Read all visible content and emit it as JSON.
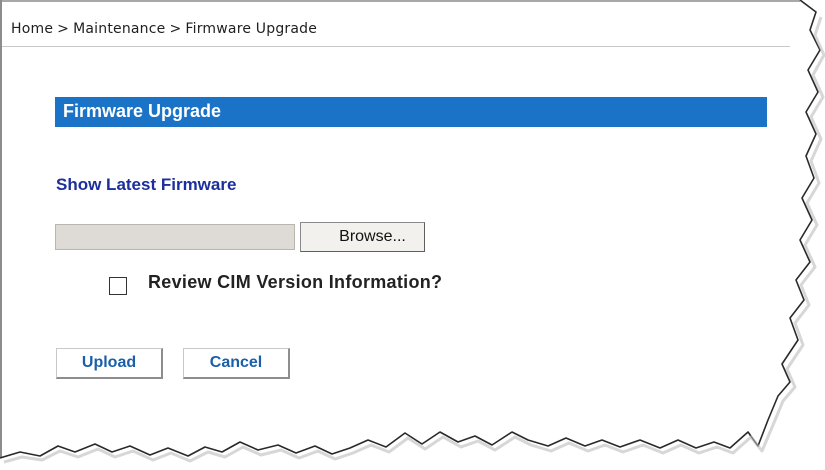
{
  "breadcrumb": {
    "items": [
      "Home",
      "Maintenance",
      "Firmware Upgrade"
    ],
    "separator": ">"
  },
  "section": {
    "title": "Firmware Upgrade"
  },
  "firmware": {
    "show_latest_link": "Show Latest Firmware",
    "file_path_value": "",
    "browse_label": "Browse...",
    "review_checkbox_label": "Review CIM Version Information?",
    "review_checked": false
  },
  "actions": {
    "upload_label": "Upload",
    "cancel_label": "Cancel"
  },
  "colors": {
    "section_bar": "#1a73c6",
    "link": "#1c2f9c",
    "button_text": "#1a5fa8"
  }
}
